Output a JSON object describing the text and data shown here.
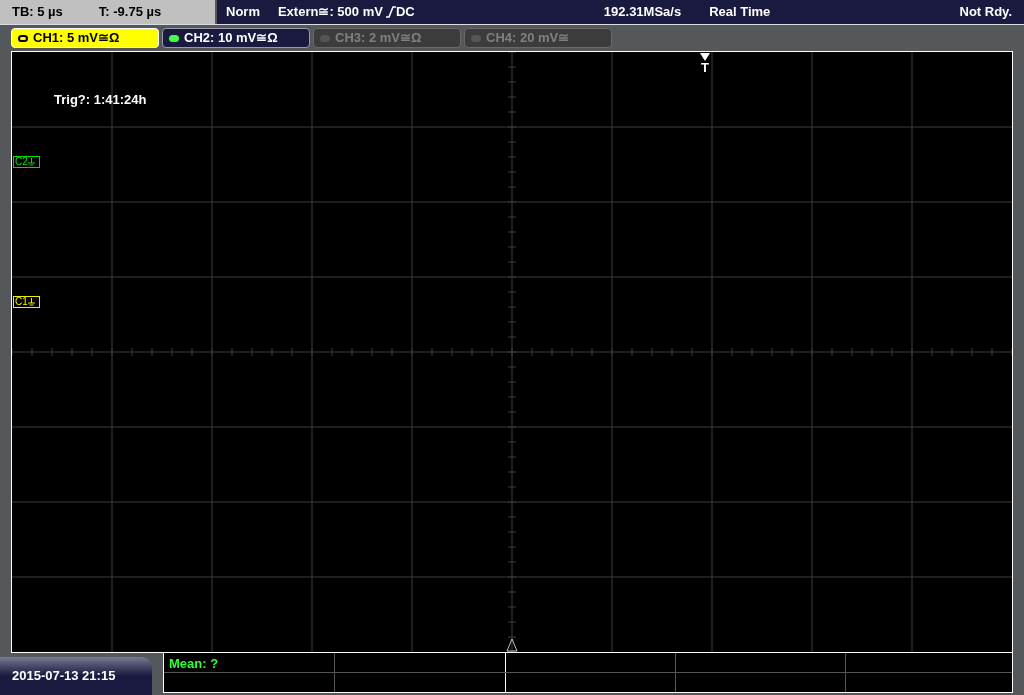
{
  "timebase": {
    "tb": "TB: 5 µs",
    "t": "T: -9.75 µs"
  },
  "trigger": {
    "mode": "Norm",
    "source": "Extern≅: 500 mV",
    "coupling": "DC"
  },
  "acquisition": {
    "sample_rate": "192.31MSa/s",
    "mode": "Real Time",
    "status": "Not Rdy."
  },
  "channels": [
    {
      "label": "CH1: 5 mV≅Ω",
      "selected": true,
      "on": true
    },
    {
      "label": "CH2: 10 mV≅Ω",
      "selected": false,
      "on": true
    },
    {
      "label": "CH3: 2 mV≅Ω",
      "selected": false,
      "on": false
    },
    {
      "label": "CH4: 20 mV≅",
      "selected": false,
      "on": false
    }
  ],
  "screen": {
    "trigger_time": "Trig?: 1:41:24h",
    "trigger_marker": "T",
    "markers": [
      {
        "label": "C2",
        "color": "#00e000"
      },
      {
        "label": "C1",
        "color": "#f0f000"
      }
    ]
  },
  "datetime": "2015-07-13 21:15",
  "measurement": "Mean: ?"
}
